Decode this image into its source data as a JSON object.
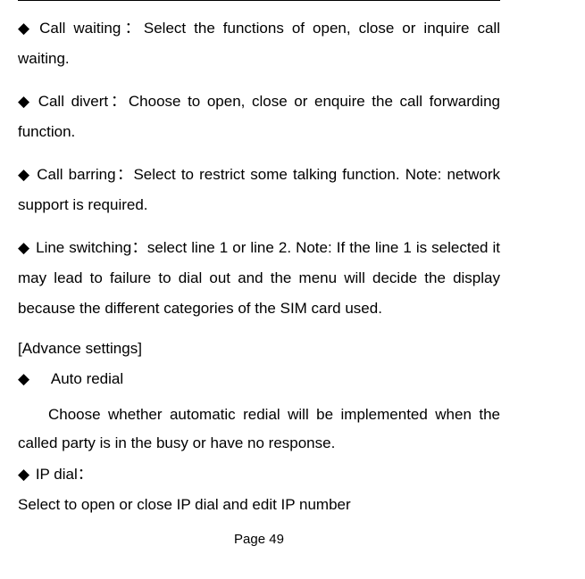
{
  "bullets": {
    "b1_label": "Call waiting",
    "b1_sep": "：",
    "b1_text": "Select the functions of open, close or inquire call waiting.",
    "b2_label": "Call divert",
    "b2_sep": "：",
    "b2_text": "Choose to open, close or enquire the call forwarding function.",
    "b3_label": "Call barring",
    "b3_sep": "：",
    "b3_text": "Select to restrict some talking function. Note: network support is required.",
    "b4_label": "Line switching",
    "b4_sep": "：",
    "b4_text": "select line 1 or line 2. Note: If the line 1 is selected it may lead to failure to dial out and the menu will decide the display because the different categories of the SIM card used."
  },
  "heading": "[Advance settings]",
  "auto_redial_label": "Auto redial",
  "auto_redial_text": "Choose whether automatic redial will be implemented when the called party is in the busy or have no response.",
  "ip_dial_label": "IP dial",
  "ip_dial_sep": "：",
  "ip_dial_text": "Select to open or close IP dial and edit IP number",
  "page_number": "Page 49",
  "diamond": "◆"
}
